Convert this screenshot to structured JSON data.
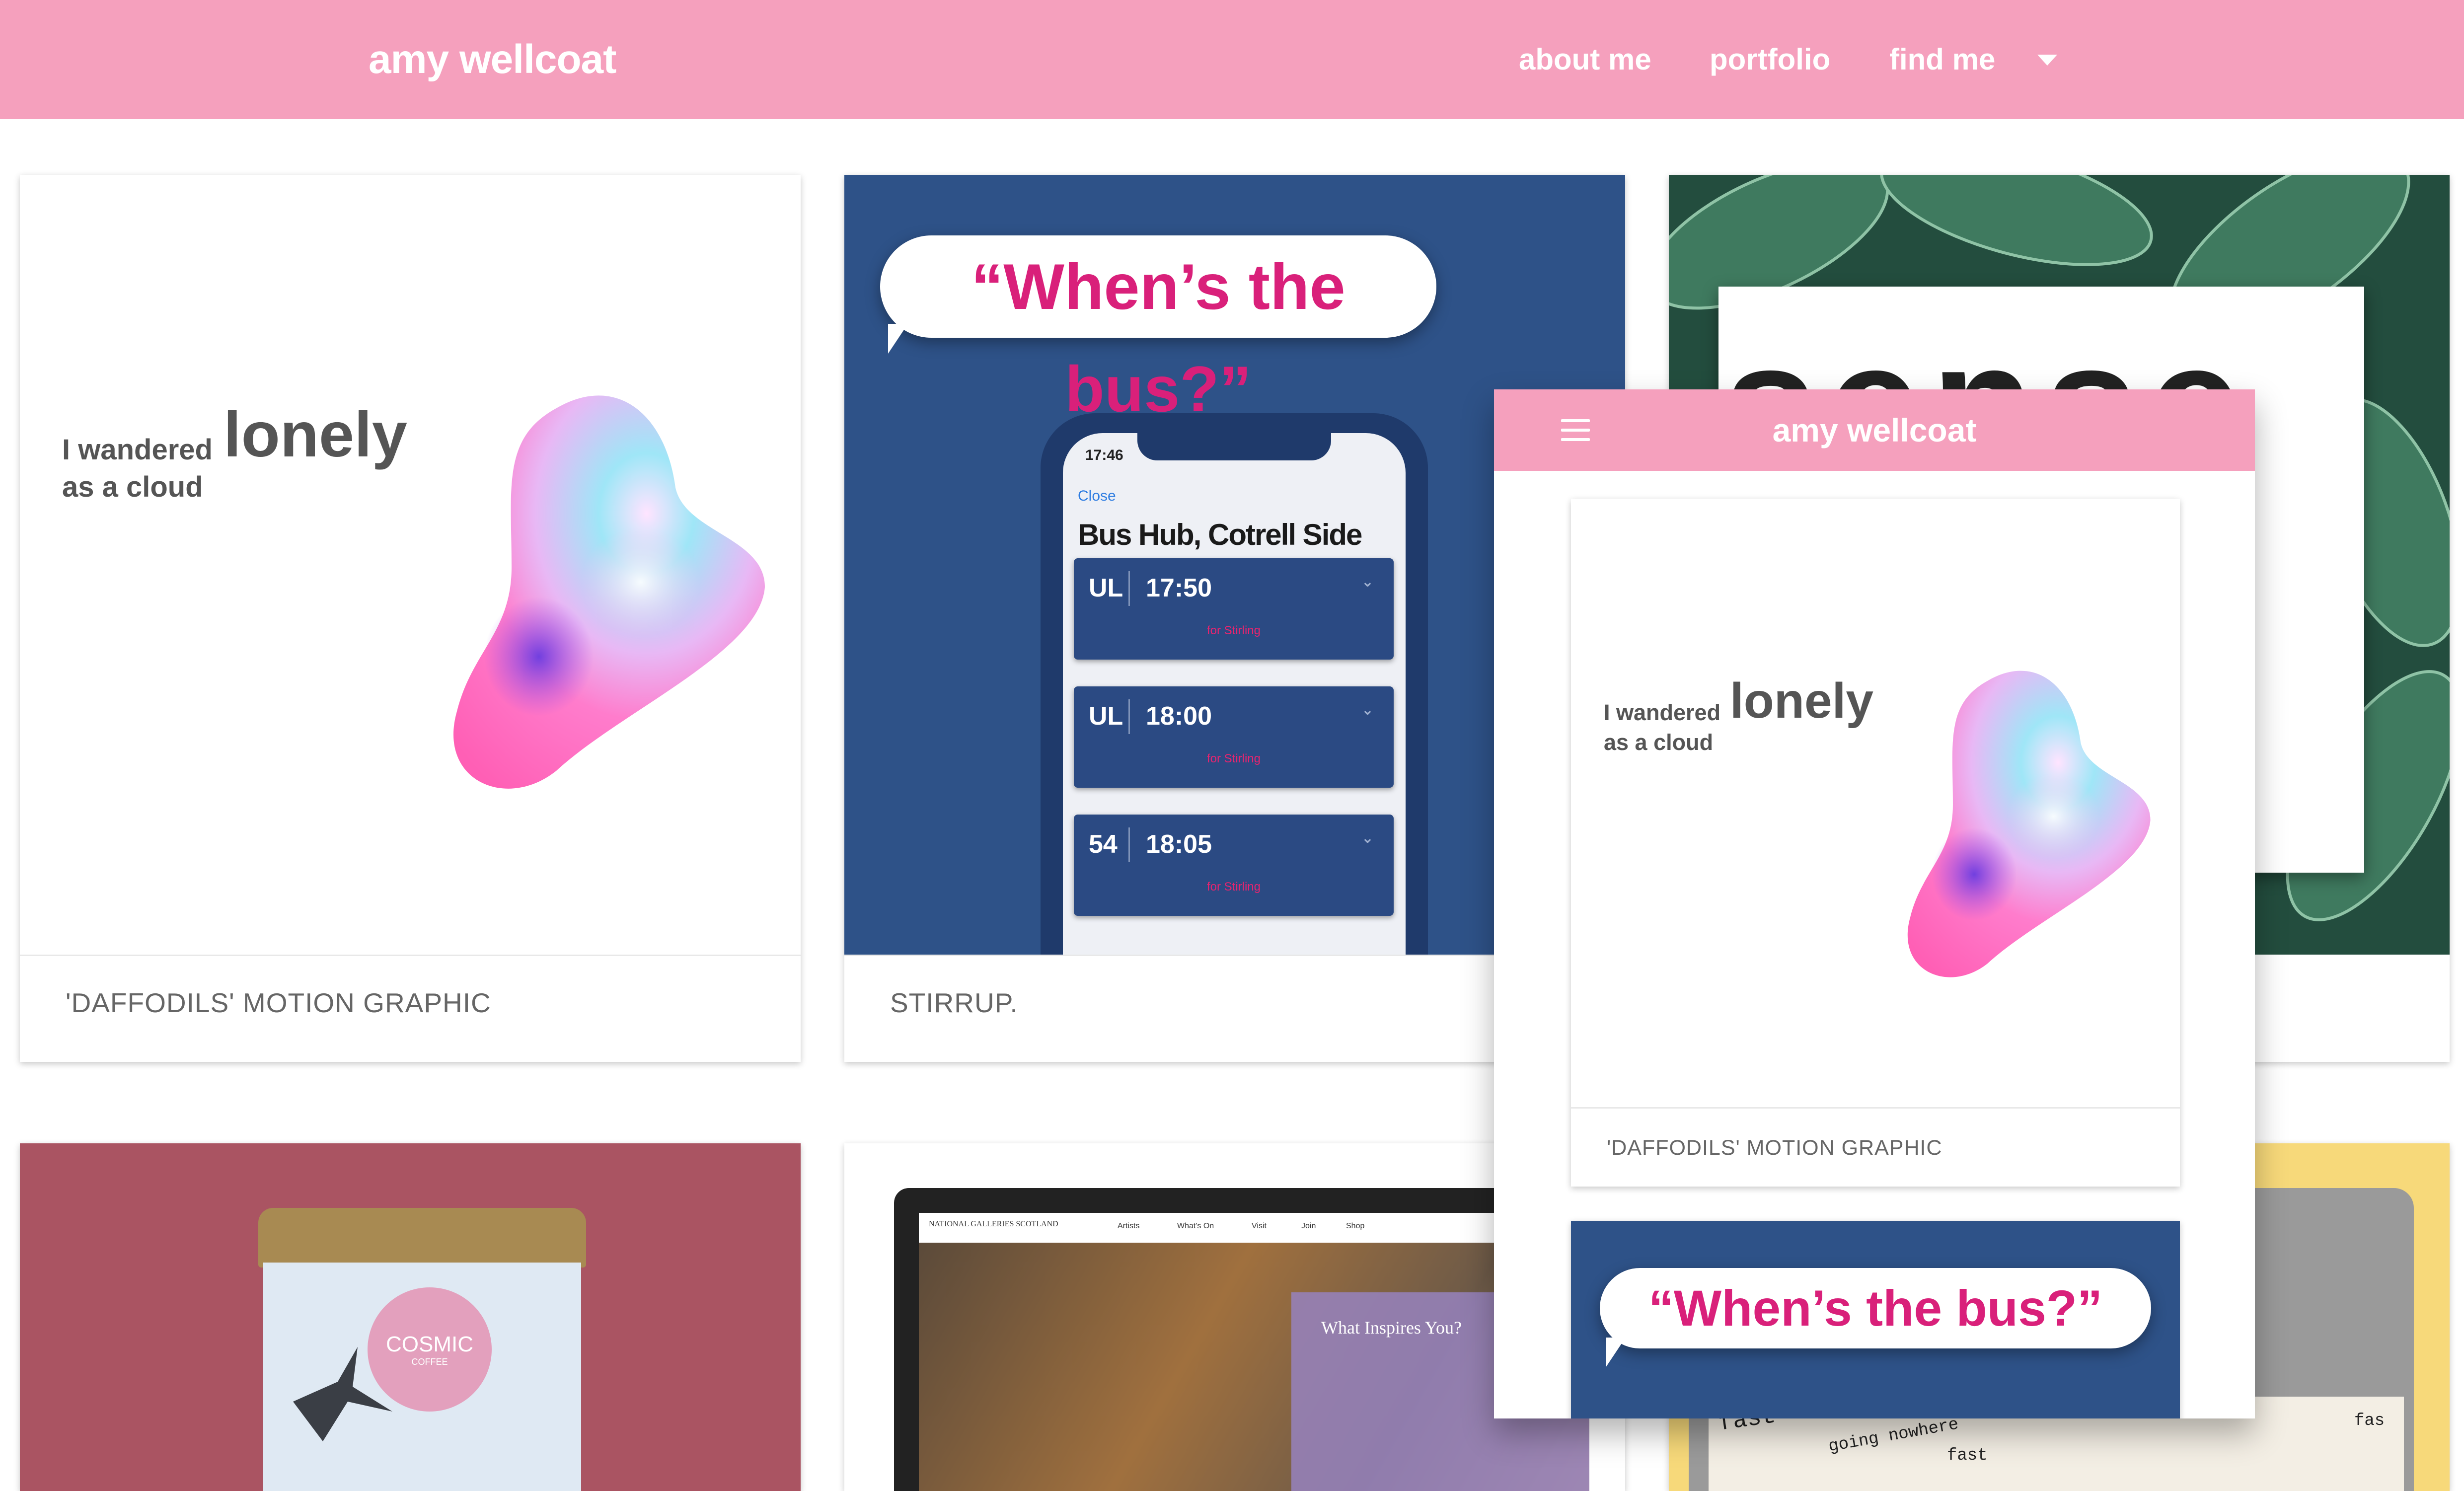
{
  "header": {
    "brand": "amy wellcoat",
    "nav": [
      "about me",
      "portfolio",
      "find me"
    ]
  },
  "colors": {
    "header_bg": "#f5a0bd",
    "accent_pink": "#d9207a",
    "bus_blue": "#2e5288"
  },
  "cards": {
    "daffodils": {
      "line1": "I wandered",
      "big": "lonely",
      "line2": "as a cloud",
      "caption": "'DAFFODILS' MOTION GRAPHIC"
    },
    "stirrup": {
      "bubble": "“When’s the bus?”",
      "phone_time": "17:46",
      "close_link": "Close",
      "stop_title": "Bus Hub, Cotrell Side",
      "rows": [
        {
          "route": "UL",
          "time": "17:50",
          "dest": "for Stirling"
        },
        {
          "route": "UL",
          "time": "18:00",
          "dest": "for Stirling"
        },
        {
          "route": "54",
          "time": "18:05",
          "dest": "for Stirling"
        }
      ],
      "caption": "STIRRUP."
    },
    "sense": {
      "word": "sense"
    },
    "cosmic": {
      "label1": "COSMIC",
      "label2": "COFFEE"
    },
    "galleries": {
      "logo_text": "NATIONAL GALLERIES SCOTLAND",
      "menu": [
        "Artists",
        "What's On",
        "Visit",
        "Join",
        "Shop"
      ],
      "panel_title": "What Inspires You?"
    },
    "fast": {
      "words": [
        "fast",
        "going nowhere",
        "fast",
        "fas"
      ]
    }
  },
  "mobile": {
    "brand": "amy wellcoat",
    "menu_icon": "hamburger-icon",
    "card": {
      "line1": "I wandered",
      "big": "lonely",
      "line2": "as a cloud",
      "caption": "'DAFFODILS' MOTION GRAPHIC"
    },
    "bubble": "“When’s the bus?”"
  }
}
